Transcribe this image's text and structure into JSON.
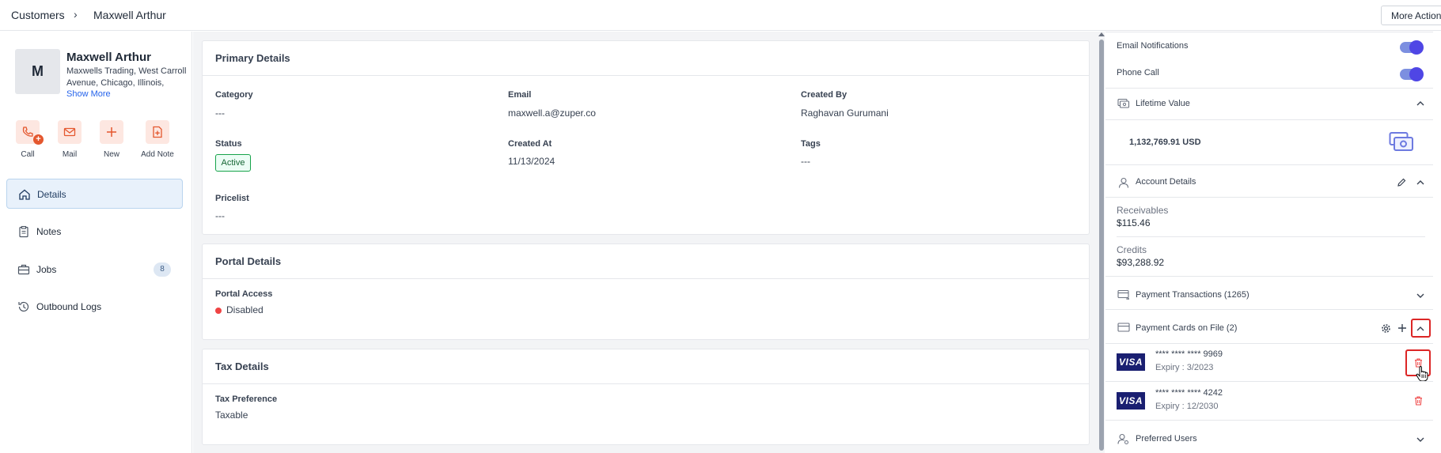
{
  "breadcrumb": {
    "root": "Customers",
    "separator": "›",
    "current": "Maxwell Arthur"
  },
  "header": {
    "more_actions_label": "More Actions"
  },
  "customer": {
    "avatar_initial": "M",
    "name": "Maxwell Arthur",
    "address": "Maxwells Trading, West Carroll Avenue, Chicago, Illinois, United...",
    "show_more": "Show More"
  },
  "quick_actions": [
    {
      "label": "Call",
      "icon": "phone-plus-icon"
    },
    {
      "label": "Mail",
      "icon": "mail-icon"
    },
    {
      "label": "New",
      "icon": "plus-icon"
    },
    {
      "label": "Add Note",
      "icon": "note-plus-icon"
    }
  ],
  "nav": [
    {
      "label": "Details",
      "icon": "home-icon",
      "active": true
    },
    {
      "label": "Notes",
      "icon": "clipboard-icon"
    },
    {
      "label": "Jobs",
      "icon": "briefcase-icon",
      "badge": "8"
    },
    {
      "label": "Outbound Logs",
      "icon": "history-icon"
    }
  ],
  "primary_details": {
    "title": "Primary Details",
    "category_label": "Category",
    "category_value": "---",
    "email_label": "Email",
    "email_value": "maxwell.a@zuper.co",
    "created_by_label": "Created By",
    "created_by_value": "Raghavan Gurumani",
    "status_label": "Status",
    "status_value": "Active",
    "created_at_label": "Created At",
    "created_at_value": "11/13/2024",
    "tags_label": "Tags",
    "tags_value": "---",
    "pricelist_label": "Pricelist",
    "pricelist_value": "---"
  },
  "portal_details": {
    "title": "Portal Details",
    "portal_access_label": "Portal Access",
    "portal_access_value": "Disabled"
  },
  "tax_details": {
    "title": "Tax Details",
    "tax_preference_label": "Tax Preference",
    "tax_preference_value": "Taxable"
  },
  "right_panel": {
    "email_notifications_label": "Email Notifications",
    "email_notifications_on": true,
    "phone_call_label": "Phone Call",
    "phone_call_on": true,
    "lifetime_value": {
      "title": "Lifetime Value",
      "amount": "1,132,769.91 USD"
    },
    "account_details": {
      "title": "Account Details",
      "receivables_label": "Receivables",
      "receivables_value": "$115.46",
      "credits_label": "Credits",
      "credits_value": "$93,288.92"
    },
    "payment_transactions_title": "Payment Transactions (1265)",
    "payment_cards": {
      "title": "Payment Cards on File (2)",
      "cards": [
        {
          "brand": "VISA",
          "number": "**** **** **** 9969",
          "expiry": "Expiry : 3/2023"
        },
        {
          "brand": "VISA",
          "number": "**** **** **** 4242",
          "expiry": "Expiry : 12/2030"
        }
      ]
    },
    "preferred_users_title": "Preferred Users"
  },
  "colors": {
    "accent_orange": "#e4572e",
    "toggle_purple": "#4f46e5",
    "highlight_red": "#dc2626",
    "visa_blue": "#1a1f71"
  }
}
